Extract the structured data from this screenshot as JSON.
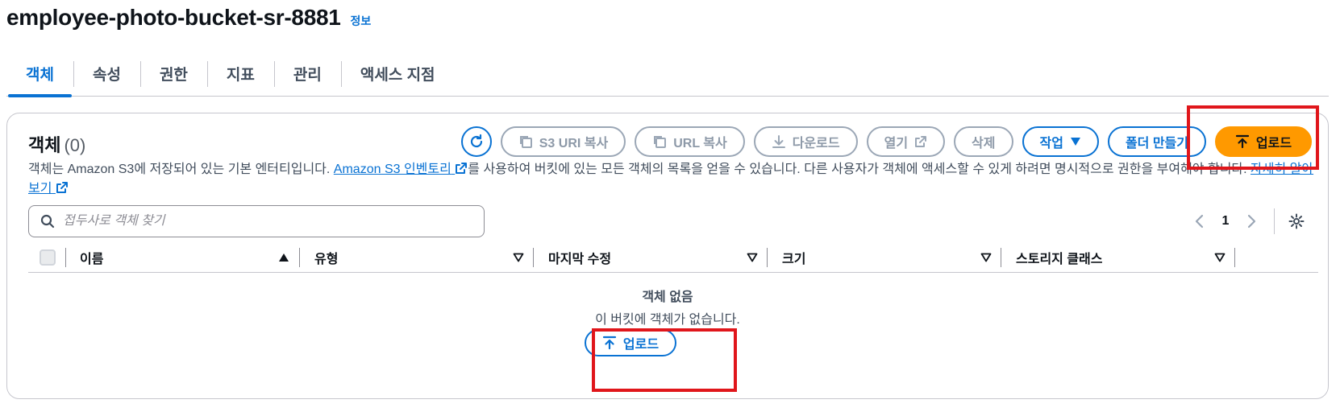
{
  "header": {
    "title": "employee-photo-bucket-sr-8881",
    "info_link": "정보"
  },
  "tabs": [
    {
      "label": "객체",
      "active": true
    },
    {
      "label": "속성",
      "active": false
    },
    {
      "label": "권한",
      "active": false
    },
    {
      "label": "지표",
      "active": false
    },
    {
      "label": "관리",
      "active": false
    },
    {
      "label": "액세스 지점",
      "active": false
    }
  ],
  "objects_panel": {
    "heading": "객체",
    "count": "(0)",
    "actions": {
      "copy_s3_uri": "S3 URI 복사",
      "copy_url": "URL 복사",
      "download": "다운로드",
      "open": "열기",
      "delete": "삭제",
      "actions_menu": "작업",
      "create_folder": "폴더 만들기",
      "upload": "업로드"
    },
    "description": {
      "part1": "객체는 Amazon S3에 저장되어 있는 기본 엔터티입니다. ",
      "inventory_link": "Amazon S3 인벤토리",
      "part2": "를 사용하여 버킷에 있는 모든 객체의 목록을 얻을 수 있습니다. 다른 사용자가 객체에 액세스할 수 있게 하려면 명시적으로 권한을 부여해야 합니다. ",
      "learn_more_link": "자세히 알아보기"
    },
    "search": {
      "placeholder": "접두사로 객체 찾기",
      "value": ""
    },
    "pagination": {
      "current_page": "1"
    },
    "table": {
      "columns": [
        "이름",
        "유형",
        "마지막 수정",
        "크기",
        "스토리지 클래스"
      ],
      "rows": []
    },
    "empty_state": {
      "title": "객체 없음",
      "description": "이 버킷에 객체가 없습니다.",
      "upload_button": "업로드"
    }
  },
  "colors": {
    "accent": "#0972d3",
    "primary_button": "#ff9900",
    "highlight_box": "#e0161b"
  }
}
